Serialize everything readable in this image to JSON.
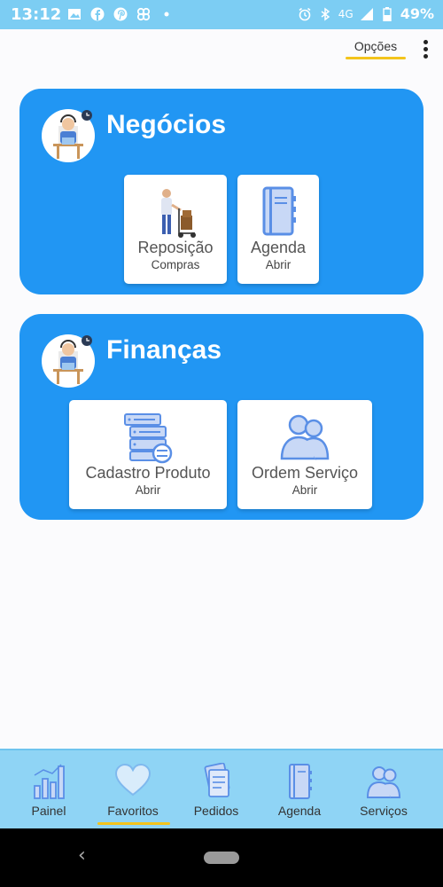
{
  "status_bar": {
    "time": "13:12",
    "network": "4G",
    "battery": "49%",
    "icons": [
      "image-icon",
      "facebook-icon",
      "pinterest-icon",
      "app-icon",
      "dot-icon",
      "alarm-icon",
      "bluetooth-icon",
      "signal-icon",
      "battery-icon"
    ]
  },
  "header": {
    "options_label": "Opções",
    "menu_icon": "kebab-menu-icon",
    "accent": "#f3c41c"
  },
  "sections": [
    {
      "title": "Negócios",
      "avatar_icon": "support-agent-icon",
      "tiles": [
        {
          "label": "Reposição",
          "sub": "Compras",
          "icon": "delivery-person-icon"
        },
        {
          "label": "Agenda",
          "sub": "Abrir",
          "icon": "notebook-icon"
        }
      ]
    },
    {
      "title": "Finanças",
      "avatar_icon": "support-agent-icon",
      "tiles": [
        {
          "label": "Cadastro Produto",
          "sub": "Abrir",
          "icon": "database-list-icon"
        },
        {
          "label": "Ordem Serviço",
          "sub": "Abrir",
          "icon": "users-icon"
        }
      ]
    }
  ],
  "bottom_nav": {
    "items": [
      {
        "label": "Painel",
        "icon": "bar-chart-icon"
      },
      {
        "label": "Favoritos",
        "icon": "heart-icon",
        "active": true
      },
      {
        "label": "Pedidos",
        "icon": "documents-icon"
      },
      {
        "label": "Agenda",
        "icon": "notebook-icon"
      },
      {
        "label": "Serviços",
        "icon": "users-icon"
      }
    ]
  },
  "colors": {
    "status_bar": "#7ccdf3",
    "card": "#2196f3",
    "bottom_nav": "#8fd4f5",
    "icon_blue": "#5a8fe6"
  }
}
